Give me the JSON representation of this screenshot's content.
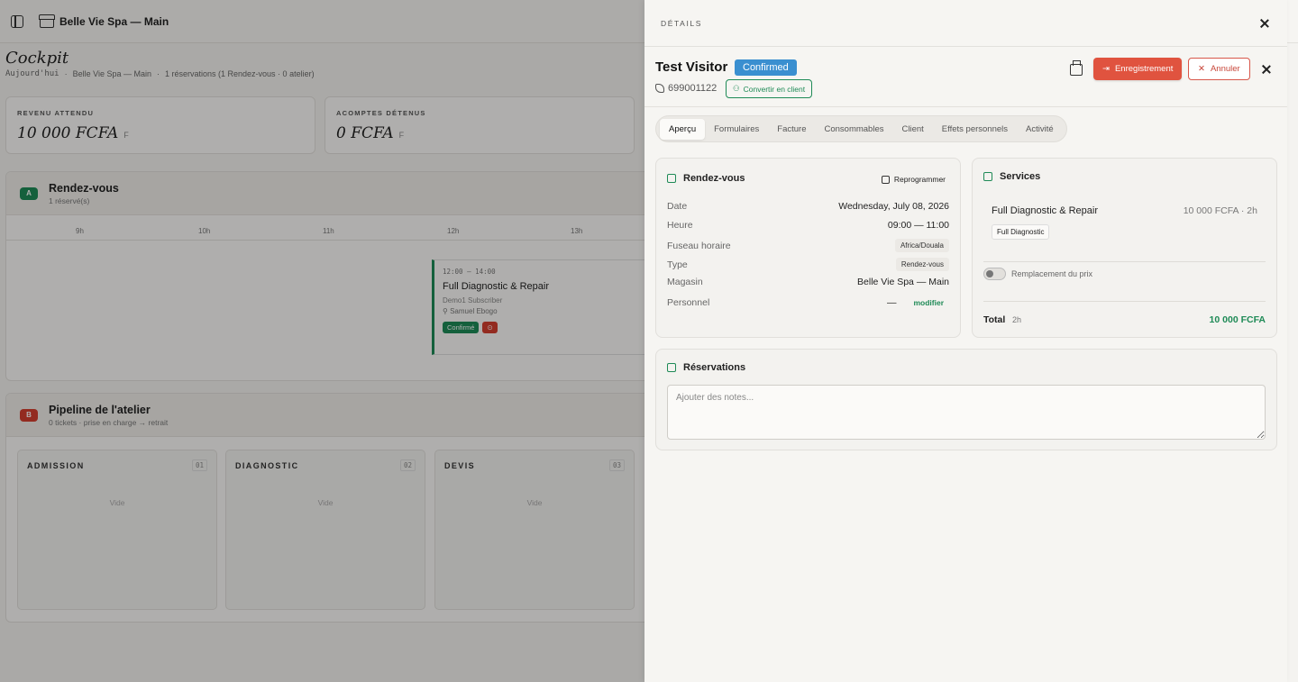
{
  "app": {
    "store_name": "Belle Vie Spa — Main",
    "page_title": "Cockpit",
    "subtitle": {
      "today": "Aujourd'hui",
      "store": "Belle Vie Spa — Main",
      "summary": "1 réservations (1 Rendez-vous · 0 atelier)"
    },
    "kpis": [
      {
        "label": "REVENU ATTENDU",
        "value": "10 000 FCFA",
        "unit": "F"
      },
      {
        "label": "ACOMPTES DÉTENUS",
        "value": "0 FCFA",
        "unit": "F"
      }
    ],
    "appointments": {
      "letter": "A",
      "title": "Rendez-vous",
      "subtitle": "1 réservé(s)",
      "hours": [
        "9h",
        "10h",
        "11h",
        "12h",
        "13h"
      ],
      "event": {
        "time": "12:00 – 14:00",
        "name": "Full Diagnostic & Repair",
        "customer": "Demo1 Subscriber",
        "staff": "Samuel Ebogo",
        "status": "Confirmé"
      }
    },
    "pipeline": {
      "letter": "B",
      "title": "Pipeline de l'atelier",
      "subtitle": "0 tickets · prise en charge → retrait",
      "columns": [
        {
          "name": "ADMISSION",
          "count": "01",
          "empty": "Vide"
        },
        {
          "name": "DIAGNOSTIC",
          "count": "02",
          "empty": "Vide"
        },
        {
          "name": "DEVIS",
          "count": "03",
          "empty": "Vide"
        }
      ]
    }
  },
  "drawer": {
    "label": "DÉTAILS",
    "visitor_name": "Test Visitor",
    "status": "Confirmed",
    "phone": "699001122",
    "convert_label": "Convertir en client",
    "checkin_label": "Enregistrement",
    "cancel_label": "Annuler",
    "tabs": [
      "Aperçu",
      "Formulaires",
      "Facture",
      "Consommables",
      "Client",
      "Effets personnels",
      "Activité"
    ],
    "appointment": {
      "title": "Rendez-vous",
      "reschedule": "Reprogrammer",
      "rows": [
        {
          "key": "Date",
          "value": "Wednesday, July 08, 2026"
        },
        {
          "key": "Heure",
          "value": "09:00 — 11:00"
        },
        {
          "key": "Fuseau horaire",
          "value": "Africa/Douala"
        },
        {
          "key": "Type",
          "value": "Rendez-vous"
        },
        {
          "key": "Magasin",
          "value": "Belle Vie Spa — Main"
        },
        {
          "key": "Personnel",
          "value": "—",
          "action": "modifier"
        }
      ]
    },
    "services": {
      "title": "Services",
      "item_name": "Full Diagnostic & Repair",
      "item_price": "10 000 FCFA · 2h",
      "item_chip": "Full Diagnostic",
      "override_label": "Remplacement du prix",
      "override_on": false,
      "total_label": "Total",
      "total_duration": "2h",
      "total_value": "10 000 FCFA"
    },
    "reservations": {
      "title": "Réservations",
      "notes_placeholder": "Ajouter des notes..."
    }
  },
  "colors": {
    "accent_green": "#1e8a56",
    "status_blue": "#3a8fd0",
    "danger_red": "#e0533f"
  }
}
